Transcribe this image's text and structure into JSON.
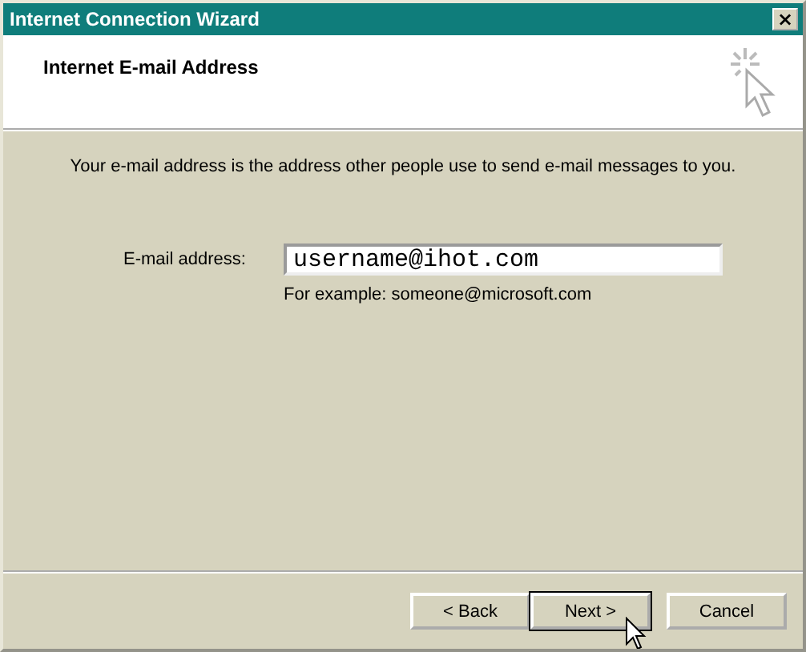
{
  "window": {
    "title": "Internet Connection Wizard",
    "close": "×"
  },
  "header": {
    "title": "Internet E-mail Address"
  },
  "intro": "Your e-mail address is the address other people use to send e-mail messages to you.",
  "email_field": {
    "label": "E-mail address:",
    "value": "username@ihot.com",
    "hint": "For example: someone@microsoft.com"
  },
  "buttons": [
    {
      "label": "< Back",
      "kind": "normal"
    },
    {
      "label": "Next >",
      "kind": "default"
    },
    {
      "label": "Cancel",
      "kind": "normal"
    }
  ]
}
